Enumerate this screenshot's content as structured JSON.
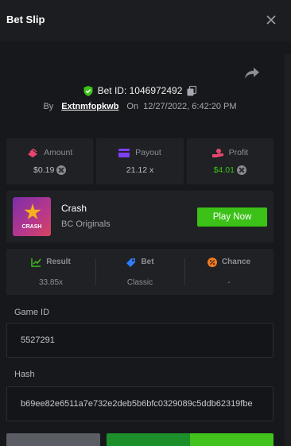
{
  "header": {
    "title": "Bet Slip"
  },
  "bet": {
    "id_text": "Bet ID: 1046972492",
    "by_label": "By",
    "username": "Extnmfopkwb",
    "on_label": "On",
    "datetime": "12/27/2022, 6:42:20 PM"
  },
  "stats": [
    {
      "label": "Amount",
      "value": "$0.19",
      "icon": "coin-stack-icon",
      "color": "#e8466f"
    },
    {
      "label": "Payout",
      "value": "21.12 x",
      "icon": "card-icon",
      "color": "#7e3ff2"
    },
    {
      "label": "Profit",
      "value": "$4.01",
      "icon": "hand-coin-icon",
      "color": "#e8466f"
    }
  ],
  "game": {
    "name": "Crash",
    "provider": "BC Originals",
    "thumb_text": "CRASH",
    "play_label": "Play Now"
  },
  "results": [
    {
      "label": "Result",
      "value": "33.85x",
      "icon": "result-icon",
      "color": "#3bc117"
    },
    {
      "label": "Bet",
      "value": "Classic",
      "icon": "bet-icon",
      "color": "#2f7cf6"
    },
    {
      "label": "Chance",
      "value": "-",
      "icon": "percent-icon",
      "color": "#f07b1d"
    }
  ],
  "fields": {
    "game_id_label": "Game ID",
    "game_id_value": "5527291",
    "hash_label": "Hash",
    "hash_value": "b69ee82e6511a7e732e2deb5b6bfc0329089c5ddb62319fbe"
  },
  "colors": {
    "accent_green": "#3bc117",
    "panel": "#202125",
    "background": "#17181b"
  }
}
